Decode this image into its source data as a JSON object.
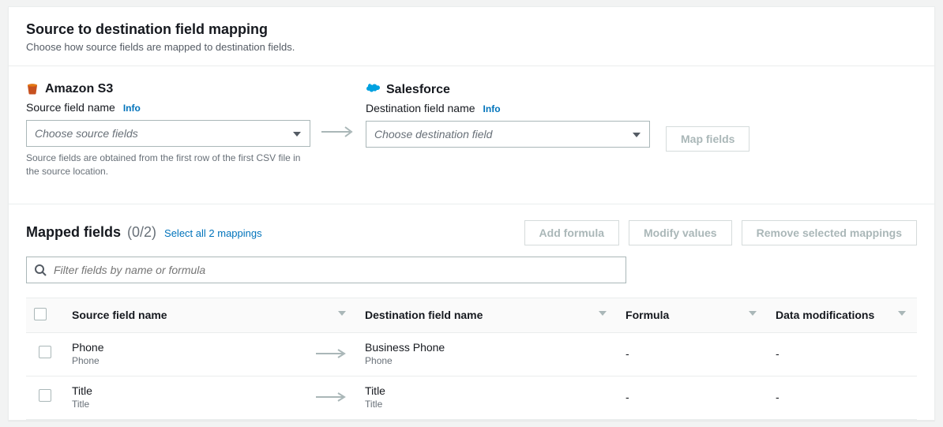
{
  "header": {
    "title": "Source to destination field mapping",
    "description": "Choose how source fields are mapped to destination fields."
  },
  "source": {
    "service": "Amazon S3",
    "label": "Source field name",
    "info": "Info",
    "placeholder": "Choose source fields",
    "helper": "Source fields are obtained from the first row of the first CSV file in the source location."
  },
  "destination": {
    "service": "Salesforce",
    "label": "Destination field name",
    "info": "Info",
    "placeholder": "Choose destination field"
  },
  "mapButton": "Map fields",
  "mapped": {
    "title": "Mapped fields",
    "count": "(0/2)",
    "selectAll": "Select all 2 mappings",
    "filterPlaceholder": "Filter fields by name or formula",
    "actions": {
      "addFormula": "Add formula",
      "modifyValues": "Modify values",
      "removeSelected": "Remove selected mappings"
    },
    "columns": {
      "source": "Source field name",
      "destination": "Destination field name",
      "formula": "Formula",
      "modifications": "Data modifications"
    },
    "rows": [
      {
        "sourceMain": "Phone",
        "sourceSub": "Phone",
        "destMain": "Business Phone",
        "destSub": "Phone",
        "formula": "-",
        "modifications": "-"
      },
      {
        "sourceMain": "Title",
        "sourceSub": "Title",
        "destMain": "Title",
        "destSub": "Title",
        "formula": "-",
        "modifications": "-"
      }
    ]
  }
}
